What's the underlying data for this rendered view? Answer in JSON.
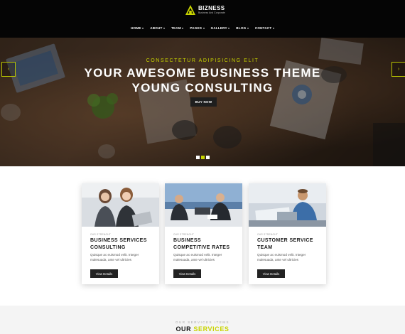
{
  "brand": {
    "name": "BIZNESS",
    "tagline": "Business And Corporate",
    "accent": "#c8d400",
    "dark": "#050505"
  },
  "nav": {
    "items": [
      {
        "label": "HOME"
      },
      {
        "label": "ABOUT"
      },
      {
        "label": "TEAM"
      },
      {
        "label": "PAGES"
      },
      {
        "label": "GALLERY"
      },
      {
        "label": "BLOG"
      },
      {
        "label": "CONTACT"
      }
    ]
  },
  "hero": {
    "subtitle": "CONSECTETUR ADIPISICING ELIT",
    "title_line1": "YOUR AWESOME BUSINESS THEME",
    "title_line2": "YOUNG CONSULTING",
    "cta": "BUY NOW",
    "prev_icon": "arrow-left-icon",
    "next_icon": "arrow-right-icon",
    "slides_total": 3,
    "active_slide": 2
  },
  "cards": [
    {
      "kicker": "OUR STRENGHT",
      "title": "BUSINESS SERVICES CONSULTING",
      "desc": "Quisque ac euismod velit. Integer malesuada, ante vel ultricies",
      "button": "View Details"
    },
    {
      "kicker": "OUR STRENGHT",
      "title": "BUSINESS COMPETITIVE RATES",
      "desc": "Quisque ac euismod velit. Integer malesuada, ante vel ultricies",
      "button": "View Details"
    },
    {
      "kicker": "OUR STRENGHT",
      "title": "CUSTOMER SERVICE TEAM",
      "desc": "Quisque ac euismod velit. Integer malesuada, ante vel ultricies",
      "button": "View Details"
    }
  ],
  "services": {
    "kicker": "OUR SERVICES ITEMS",
    "title_a": "OUR",
    "title_b": "SERVICES"
  }
}
